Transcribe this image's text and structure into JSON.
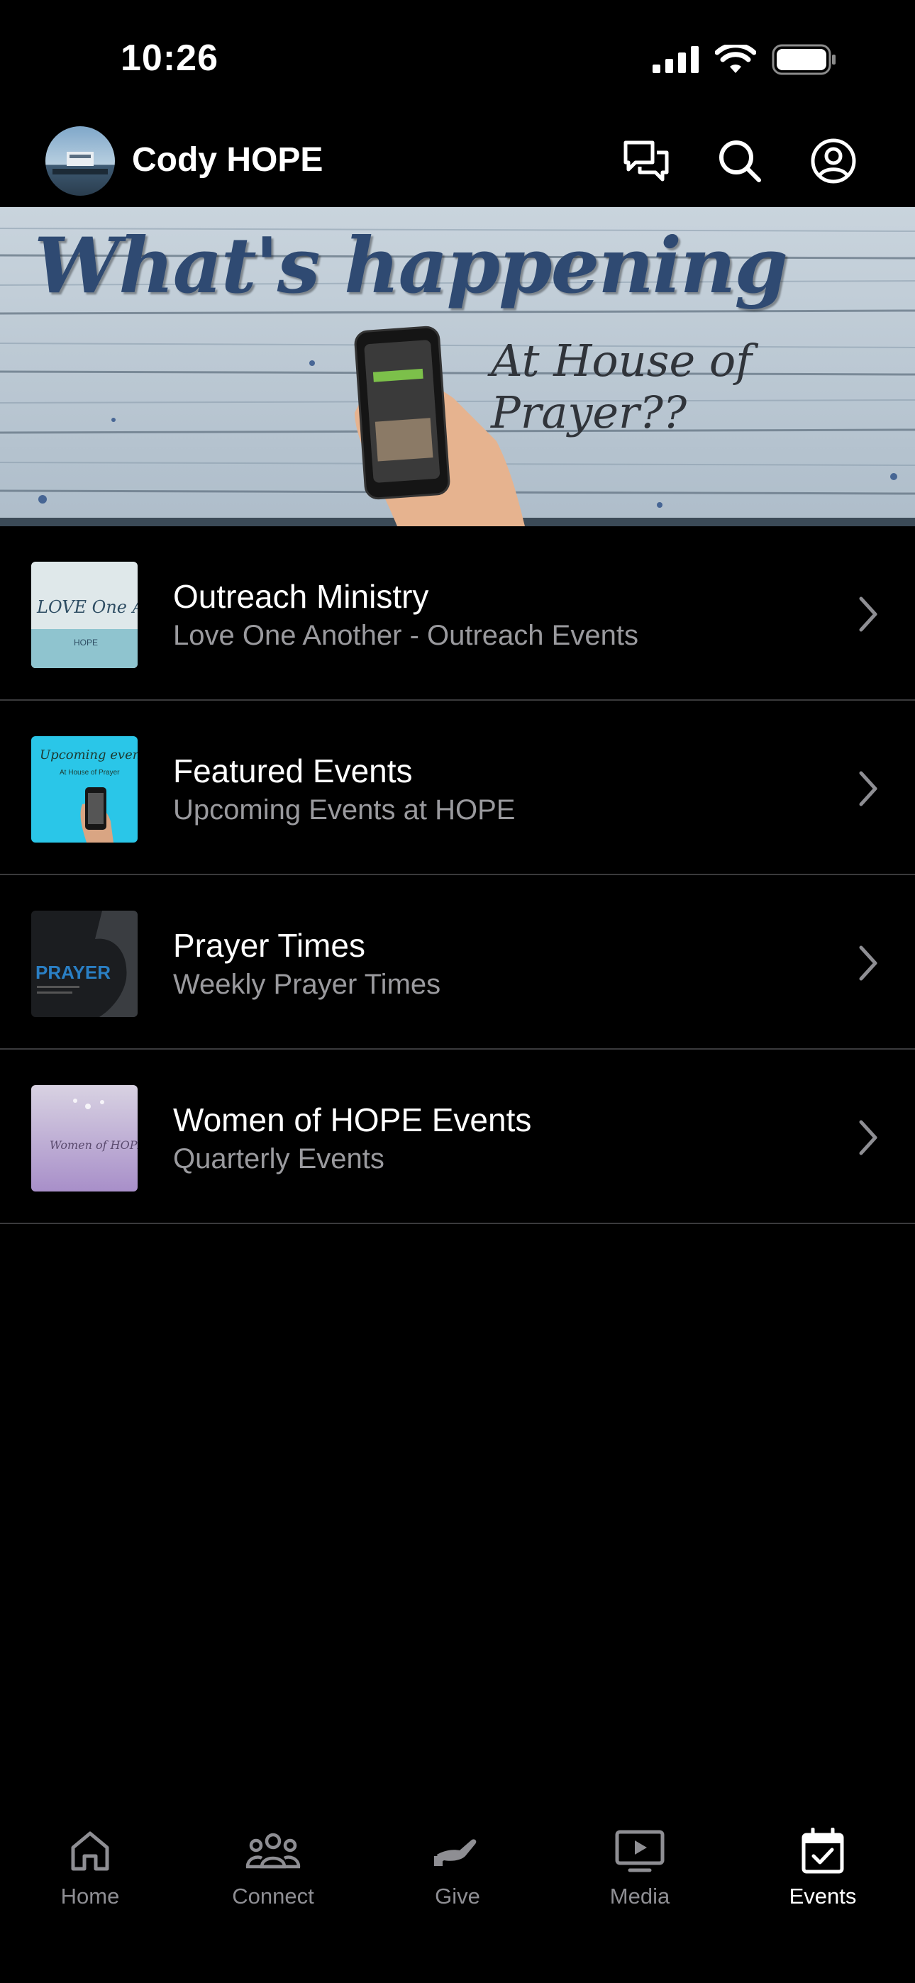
{
  "status_bar": {
    "time": "10:26"
  },
  "header": {
    "title": "Cody HOPE",
    "icons": [
      "chat-icon",
      "search-icon",
      "profile-icon"
    ]
  },
  "banner": {
    "title": "What's happening",
    "subtitle": "At House of Prayer??"
  },
  "events": [
    {
      "title": "Outreach Ministry",
      "subtitle": "Love One Another - Outreach Events",
      "thumbnail_icon": "love-one-another-thumbnail",
      "thumb_text": "LOVE One Another"
    },
    {
      "title": "Featured Events",
      "subtitle": "Upcoming Events at HOPE",
      "thumbnail_icon": "upcoming-events-thumbnail",
      "thumb_text": "Upcoming events"
    },
    {
      "title": "Prayer Times",
      "subtitle": "Weekly Prayer Times",
      "thumbnail_icon": "prayer-thumbnail",
      "thumb_text": "PRAYER"
    },
    {
      "title": "Women of HOPE Events",
      "subtitle": "Quarterly Events",
      "thumbnail_icon": "women-of-hope-thumbnail",
      "thumb_text": "Women of HOPE"
    }
  ],
  "tab_bar": {
    "tabs": [
      {
        "label": "Home",
        "icon": "home-icon",
        "active": false
      },
      {
        "label": "Connect",
        "icon": "people-icon",
        "active": false
      },
      {
        "label": "Give",
        "icon": "give-icon",
        "active": false
      },
      {
        "label": "Media",
        "icon": "media-icon",
        "active": false
      },
      {
        "label": "Events",
        "icon": "calendar-check-icon",
        "active": true
      }
    ]
  },
  "colors": {
    "background": "#000000",
    "text_primary": "#ffffff",
    "text_secondary": "#9a9a9e",
    "tab_inactive": "#8e8e93",
    "separator": "#3a3a3c",
    "banner_title": "#2f4a72"
  }
}
